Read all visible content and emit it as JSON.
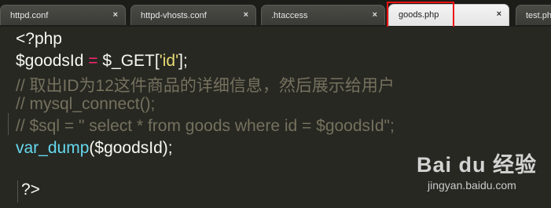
{
  "tabs": [
    {
      "label": "httpd.conf",
      "close": "×"
    },
    {
      "label": "httpd-vhosts.conf",
      "close": "×"
    },
    {
      "label": ".htaccess",
      "close": "×"
    },
    {
      "label": "goods.php",
      "close": "×",
      "active": true
    },
    {
      "label": "test.ph",
      "close": ""
    }
  ],
  "code": {
    "line1": "<?php",
    "line2": {
      "a": "$goodsId",
      "b": " = ",
      "c": "$_GET[",
      "d": "'id'",
      "e": "];"
    },
    "line3": "// 取出ID为12这件商品的详细信息，然后展示给用户",
    "line4": "// mysql_connect();",
    "line5": "// $sql = \" select * from goods where id = $goodsId\";",
    "line6": {
      "a": "var_dump",
      "b": "($goodsId);"
    },
    "line7": "?>"
  },
  "watermark": {
    "main": "Bai du 经验",
    "sub": "jingyan.baidu.com"
  }
}
